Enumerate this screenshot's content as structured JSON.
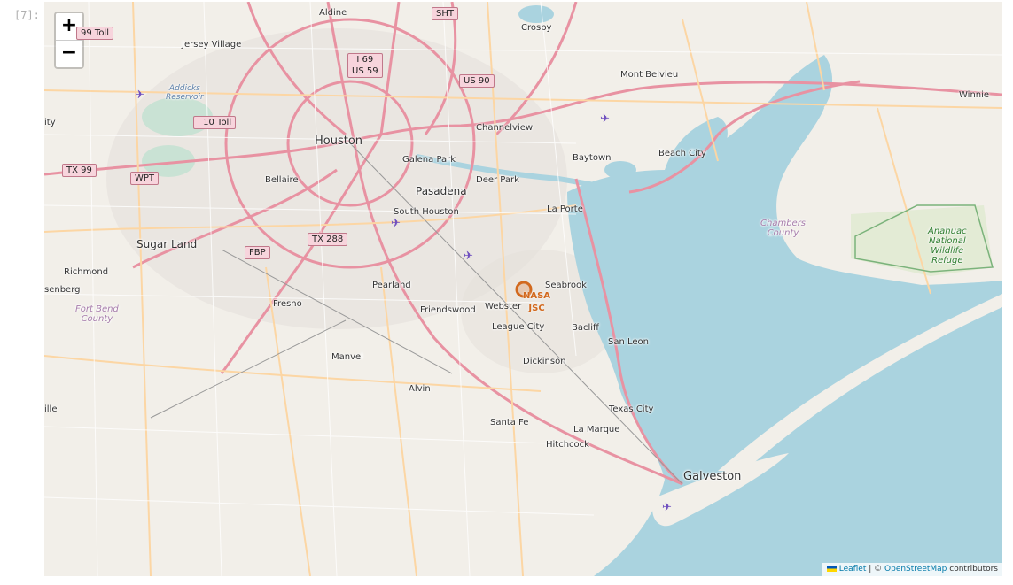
{
  "notebook": {
    "prompt": "[7]:"
  },
  "controls": {
    "zoom_in": "+",
    "zoom_out": "−"
  },
  "attribution": {
    "leaflet": "Leaflet",
    "separator": " | © ",
    "osm": "OpenStreetMap",
    "contributors": " contributors"
  },
  "colors": {
    "water": "#aad3df",
    "land": "#f2efe9",
    "highway": "#e892a2",
    "primary": "#fcd6a4",
    "marker": "#d2691e"
  },
  "places": {
    "aldine": "Aldine",
    "crosby": "Crosby",
    "jersey_village": "Jersey Village",
    "mont_belvieu": "Mont Belvieu",
    "winnie": "Winnie",
    "houston": "Houston",
    "channelview": "Channelview",
    "galena_park": "Galena Park",
    "baytown": "Baytown",
    "beach_city": "Beach City",
    "bellaire": "Bellaire",
    "pasadena": "Pasadena",
    "deer_park": "Deer Park",
    "south_houston": "South Houston",
    "la_porte": "La Porte",
    "sugar_land": "Sugar Land",
    "richmond": "Richmond",
    "rosenberg": "senberg",
    "fresno": "Fresno",
    "pearland": "Pearland",
    "friendswood": "Friendswood",
    "webster": "Webster",
    "seabrook": "Seabrook",
    "league_city": "League City",
    "bacliff": "Bacliff",
    "san_leon": "San Leon",
    "dickinson": "Dickinson",
    "manvel": "Manvel",
    "alvin": "Alvin",
    "texas_city": "Texas City",
    "santa_fe": "Santa Fe",
    "la_marque": "La Marque",
    "hitchcock": "Hitchcock",
    "galveston": "Galveston",
    "city_left": "ity",
    "ville_left": "ille"
  },
  "regions": {
    "fort_bend": "Fort Bend\nCounty",
    "chambers": "Chambers\nCounty",
    "addicks": "Addicks\nReservoir",
    "anahuac": "Anahuac\nNational\nWildlife\nRefuge"
  },
  "shields": {
    "toll_99": "99 Toll",
    "sht": "SHT",
    "i69": "I 69\nUS 59",
    "us90": "US 90",
    "i10toll": "I 10 Toll",
    "tx99": "TX 99",
    "wpt": "WPT",
    "tx288": "TX 288",
    "fbp": "FBP"
  },
  "marker": {
    "label": "NASA\nJSC",
    "icon": "circle-marker"
  },
  "airports": {
    "icon": "airplane-icon"
  }
}
